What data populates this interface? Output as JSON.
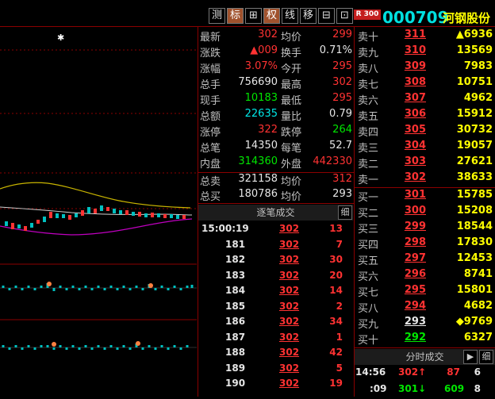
{
  "toolbar": {
    "buttons": [
      "测",
      "标",
      "⊞",
      "权",
      "线",
      "移",
      "⊟",
      "⊡"
    ]
  },
  "stock": {
    "badge": "R 300",
    "code": "000709",
    "name": "河钢股份"
  },
  "quote": {
    "left": [
      {
        "label": "最新",
        "value": "302"
      },
      {
        "label": "涨跌",
        "value": "▲009"
      },
      {
        "label": "涨幅",
        "value": "3.07%"
      },
      {
        "label": "总手",
        "value": "756690"
      },
      {
        "label": "现手",
        "value": "10183"
      },
      {
        "label": "总额",
        "value": "22635"
      },
      {
        "label": "涨停",
        "value": "322"
      },
      {
        "label": "总笔",
        "value": "14350"
      },
      {
        "label": "内盘",
        "value": "314360"
      },
      {
        "label": "总卖",
        "value": "321158"
      },
      {
        "label": "总买",
        "value": "180786"
      }
    ],
    "right": [
      {
        "label": "均价",
        "value": "299"
      },
      {
        "label": "换手",
        "value": "0.71%"
      },
      {
        "label": "今开",
        "value": "295"
      },
      {
        "label": "最高",
        "value": "302"
      },
      {
        "label": "最低",
        "value": "295"
      },
      {
        "label": "量比",
        "value": "0.79"
      },
      {
        "label": "跌停",
        "value": "264"
      },
      {
        "label": "每笔",
        "value": "52.7"
      },
      {
        "label": "外盘",
        "value": "442330"
      },
      {
        "label": "均价",
        "value": "312"
      },
      {
        "label": "均价",
        "value": "293"
      }
    ]
  },
  "orderbook": {
    "sell": [
      {
        "label": "卖十",
        "price": "311",
        "vol": "▲6936"
      },
      {
        "label": "卖九",
        "price": "310",
        "vol": "13569"
      },
      {
        "label": "卖八",
        "price": "309",
        "vol": "7983"
      },
      {
        "label": "卖七",
        "price": "308",
        "vol": "10751"
      },
      {
        "label": "卖六",
        "price": "307",
        "vol": "4962"
      },
      {
        "label": "卖五",
        "price": "306",
        "vol": "15912"
      },
      {
        "label": "卖四",
        "price": "305",
        "vol": "30732"
      },
      {
        "label": "卖三",
        "price": "304",
        "vol": "19057"
      },
      {
        "label": "卖二",
        "price": "303",
        "vol": "27621"
      },
      {
        "label": "卖一",
        "price": "302",
        "vol": "38633"
      }
    ],
    "buy": [
      {
        "label": "买一",
        "price": "301",
        "vol": "15785"
      },
      {
        "label": "买二",
        "price": "300",
        "vol": "15208"
      },
      {
        "label": "买三",
        "price": "299",
        "vol": "18544"
      },
      {
        "label": "买四",
        "price": "298",
        "vol": "17830"
      },
      {
        "label": "买五",
        "price": "297",
        "vol": "12453"
      },
      {
        "label": "买六",
        "price": "296",
        "vol": "8741"
      },
      {
        "label": "买七",
        "price": "295",
        "vol": "15801"
      },
      {
        "label": "买八",
        "price": "294",
        "vol": "4682"
      },
      {
        "label": "买九",
        "price": "293",
        "vol": "◆9769"
      },
      {
        "label": "买十",
        "price": "292",
        "vol": "6327"
      }
    ]
  },
  "ticks": {
    "title": "逐笔成交",
    "detail_btn": "细",
    "rows": [
      {
        "time": "15:00:19",
        "price": "302",
        "vol": "13"
      },
      {
        "time": "181",
        "price": "302",
        "vol": "7"
      },
      {
        "time": "182",
        "price": "302",
        "vol": "30"
      },
      {
        "time": "183",
        "price": "302",
        "vol": "20"
      },
      {
        "time": "184",
        "price": "302",
        "vol": "14"
      },
      {
        "time": "185",
        "price": "302",
        "vol": "2"
      },
      {
        "time": "186",
        "price": "302",
        "vol": "34"
      },
      {
        "time": "187",
        "price": "302",
        "vol": "1"
      },
      {
        "time": "188",
        "price": "302",
        "vol": "42"
      },
      {
        "time": "189",
        "price": "302",
        "vol": "5"
      },
      {
        "time": "190",
        "price": "302",
        "vol": "19"
      }
    ]
  },
  "fenshi": {
    "title": "分时成交",
    "arrow_btn": "▶",
    "detail_btn": "细",
    "rows": [
      {
        "time": "14:56",
        "price": "302↑",
        "vol": "87",
        "n": "6"
      },
      {
        "time": ":09",
        "price": "301↓",
        "vol": "609",
        "n": "8"
      }
    ]
  },
  "colors": {
    "up": "#ff3232",
    "down": "#00e600",
    "grid": "#8b0000",
    "code": "#00e0e0"
  }
}
